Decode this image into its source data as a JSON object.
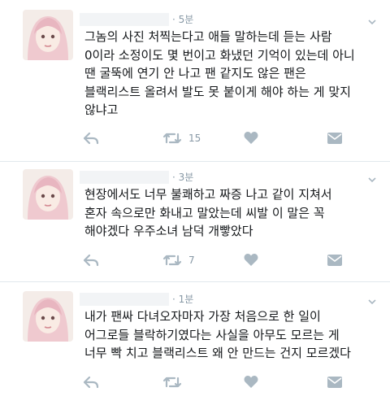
{
  "tweets": [
    {
      "time": "· 5분",
      "text": "그놈의 사진 처찍는다고 애들 말하는데 듣는 사람\n0이라 소정이도 몇 번이고 화냈던 기억이 있는데 아니\n땐 굴뚝에 연기 안 나고 팬 같지도 않은 팬은\n블랙리스트 올려서 발도 못 붙이게 해야 하는 게 맞지\n않냐고",
      "retweets": "15",
      "likes": ""
    },
    {
      "time": "· 3분",
      "text": "현장에서도 너무 불쾌하고 짜증 나고 같이 지쳐서\n혼자 속으로만 화내고 말았는데 씨발 이 말은 꼭\n해야겠다 우주소녀 남덕 개빻았다",
      "retweets": "7",
      "likes": ""
    },
    {
      "time": "· 1분",
      "text": "내가 팬싸 다녀오자마자 가장 처음으로 한 일이\n어그로들 블락하기였다는 사실을 아무도 모르는 게\n너무 빡 치고 블랙리스트 왜 안 만드는 건지 모르겠다",
      "retweets": "",
      "likes": ""
    }
  ],
  "icons": {
    "reply": "reply-icon",
    "retweet": "retweet-icon",
    "like": "heart-icon",
    "dm": "envelope-icon",
    "caret": "chevron-down-icon"
  },
  "colors": {
    "icon_gray": "#aab8c2",
    "text": "#14171a",
    "meta": "#8899a6",
    "divider": "#e1e8ed"
  }
}
